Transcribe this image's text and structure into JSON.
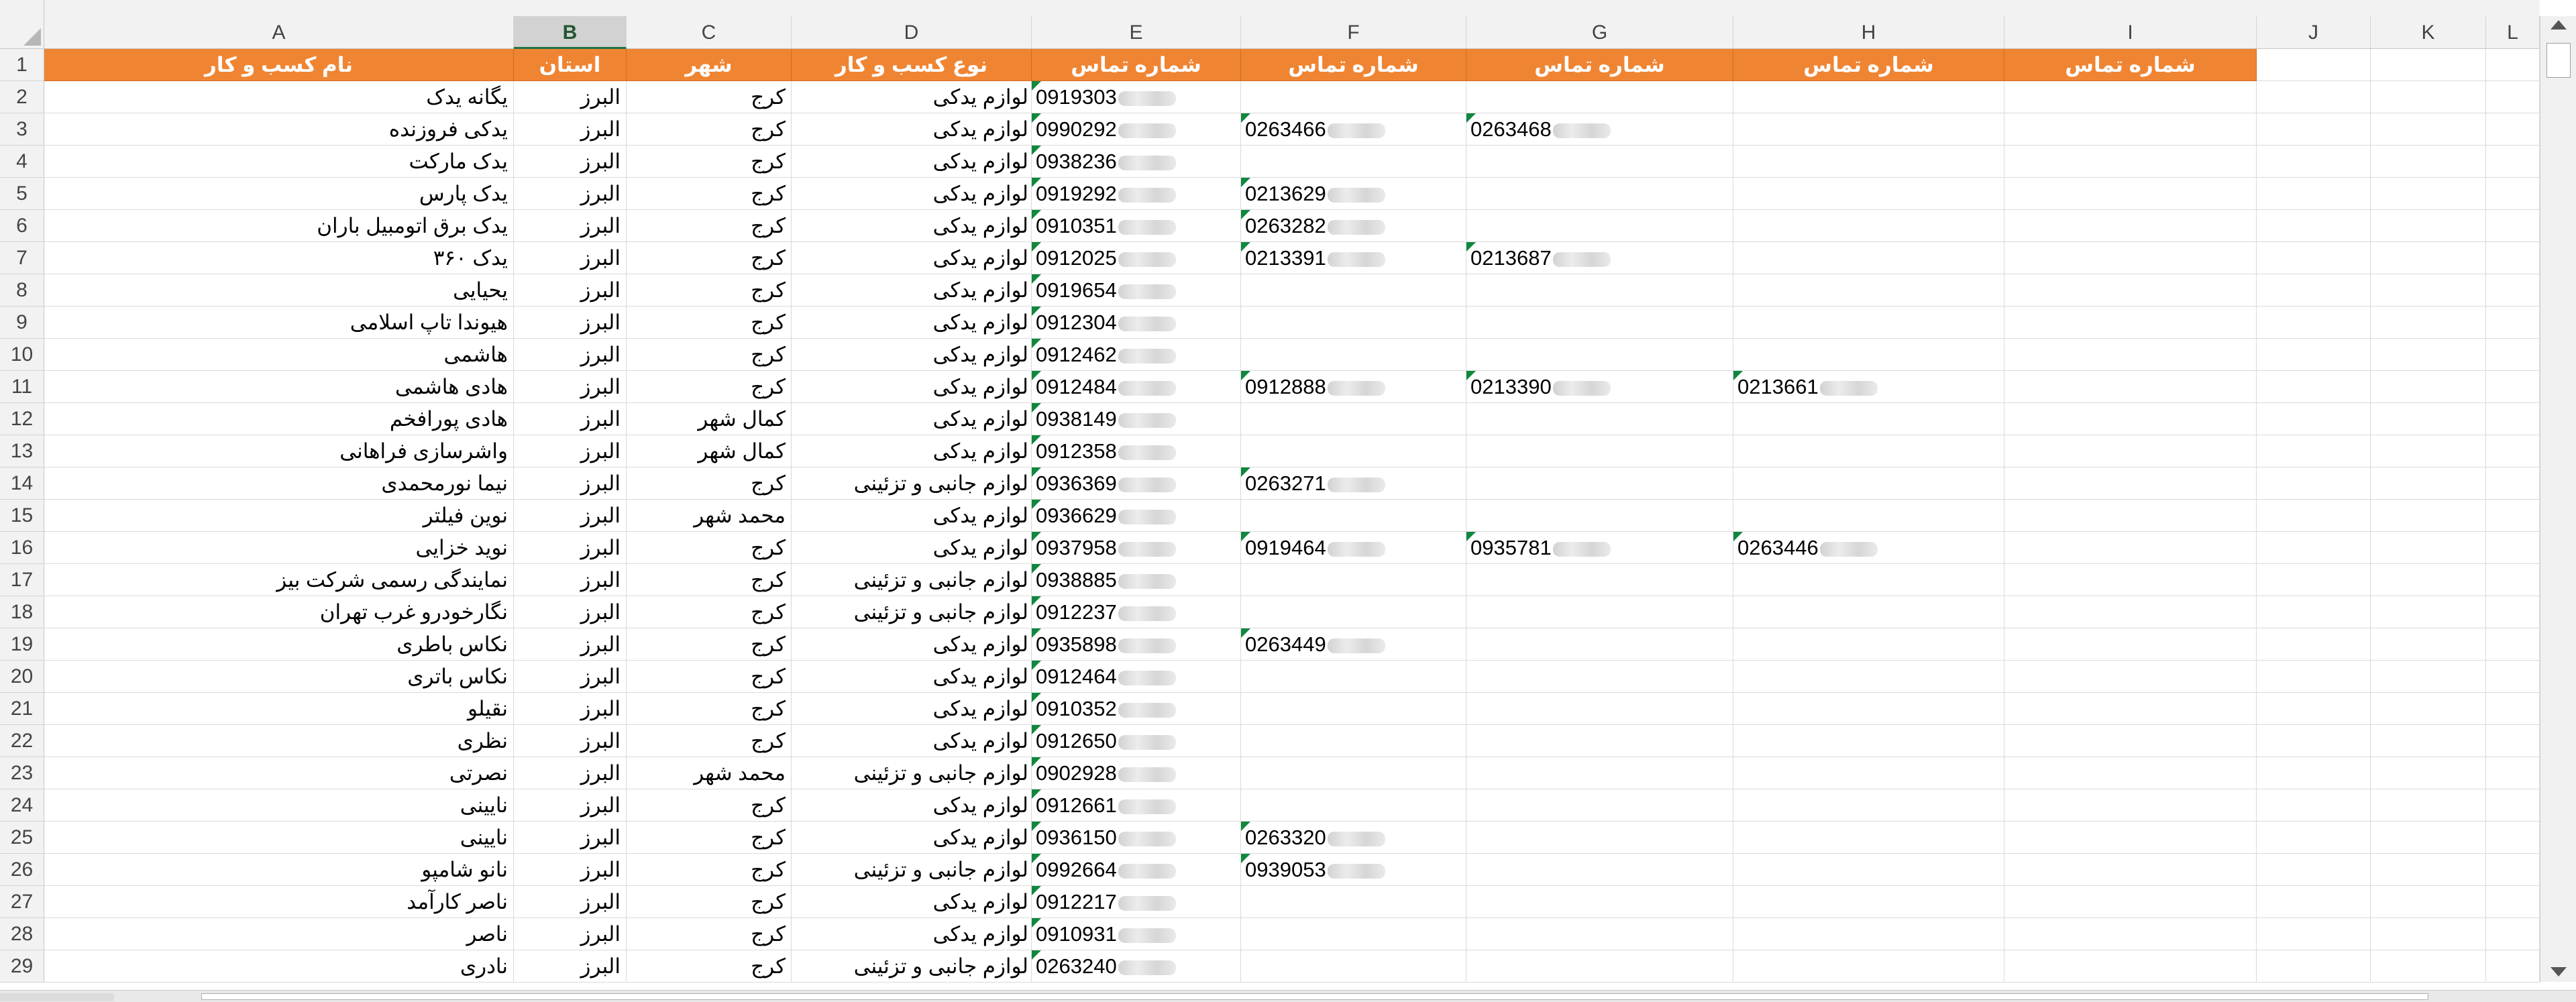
{
  "columns": [
    "A",
    "B",
    "C",
    "D",
    "E",
    "F",
    "G",
    "H",
    "I",
    "J",
    "K",
    "L"
  ],
  "selected_column": "B",
  "header_row": {
    "row_number": "1",
    "A": "نام کسب و کار",
    "B": "استان",
    "C": "شهر",
    "D": "نوع کسب و کار",
    "E": "شماره تماس",
    "F": "شماره تماس",
    "G": "شماره تماس",
    "H": "شماره تماس",
    "I": "شماره تماس"
  },
  "rows": [
    {
      "n": "2",
      "name": "یگانه یدک",
      "province": "البرز",
      "city": "کرج",
      "type": "لوازم یدکی",
      "e": "0919303",
      "f": "",
      "g": "",
      "h": ""
    },
    {
      "n": "3",
      "name": "یدکی فروزنده",
      "province": "البرز",
      "city": "کرج",
      "type": "لوازم یدکی",
      "e": "0990292",
      "f": "0263466",
      "g": "0263468",
      "h": ""
    },
    {
      "n": "4",
      "name": "یدک مارکت",
      "province": "البرز",
      "city": "کرج",
      "type": "لوازم یدکی",
      "e": "0938236",
      "f": "",
      "g": "",
      "h": ""
    },
    {
      "n": "5",
      "name": "یدک پارس",
      "province": "البرز",
      "city": "کرج",
      "type": "لوازم یدکی",
      "e": "0919292",
      "f": "0213629",
      "g": "",
      "h": ""
    },
    {
      "n": "6",
      "name": "یدک برق اتومبیل باران",
      "province": "البرز",
      "city": "کرج",
      "type": "لوازم یدکی",
      "e": "0910351",
      "f": "0263282",
      "g": "",
      "h": ""
    },
    {
      "n": "7",
      "name": "یدک ۳۶۰",
      "province": "البرز",
      "city": "کرج",
      "type": "لوازم یدکی",
      "e": "0912025",
      "f": "0213391",
      "g": "0213687",
      "h": ""
    },
    {
      "n": "8",
      "name": "یحیایی",
      "province": "البرز",
      "city": "کرج",
      "type": "لوازم یدکی",
      "e": "0919654",
      "f": "",
      "g": "",
      "h": ""
    },
    {
      "n": "9",
      "name": "هیوندا تاپ اسلامی",
      "province": "البرز",
      "city": "کرج",
      "type": "لوازم یدکی",
      "e": "0912304",
      "f": "",
      "g": "",
      "h": ""
    },
    {
      "n": "10",
      "name": "هاشمی",
      "province": "البرز",
      "city": "کرج",
      "type": "لوازم یدکی",
      "e": "0912462",
      "f": "",
      "g": "",
      "h": ""
    },
    {
      "n": "11",
      "name": "هادی هاشمی",
      "province": "البرز",
      "city": "کرج",
      "type": "لوازم یدکی",
      "e": "0912484",
      "f": "0912888",
      "g": "0213390",
      "h": "0213661"
    },
    {
      "n": "12",
      "name": "هادی پورافخم",
      "province": "البرز",
      "city": "کمال شهر",
      "type": "لوازم یدکی",
      "e": "0938149",
      "f": "",
      "g": "",
      "h": ""
    },
    {
      "n": "13",
      "name": "واشرسازی فراهانی",
      "province": "البرز",
      "city": "کمال شهر",
      "type": "لوازم یدکی",
      "e": "0912358",
      "f": "",
      "g": "",
      "h": ""
    },
    {
      "n": "14",
      "name": "نیما نورمحمدی",
      "province": "البرز",
      "city": "کرج",
      "type": "لوازم جانبی و تزئینی",
      "e": "0936369",
      "f": "0263271",
      "g": "",
      "h": ""
    },
    {
      "n": "15",
      "name": "نوین فیلتر",
      "province": "البرز",
      "city": "محمد شهر",
      "type": "لوازم یدکی",
      "e": "0936629",
      "f": "",
      "g": "",
      "h": ""
    },
    {
      "n": "16",
      "name": "نوید خزایی",
      "province": "البرز",
      "city": "کرج",
      "type": "لوازم یدکی",
      "e": "0937958",
      "f": "0919464",
      "g": "0935781",
      "h": "0263446"
    },
    {
      "n": "17",
      "name": "نمایندگی رسمی شرکت بیز",
      "province": "البرز",
      "city": "کرج",
      "type": "لوازم جانبی و تزئینی",
      "e": "0938885",
      "f": "",
      "g": "",
      "h": ""
    },
    {
      "n": "18",
      "name": "نگارخودرو غرب تهران",
      "province": "البرز",
      "city": "کرج",
      "type": "لوازم جانبی و تزئینی",
      "e": "0912237",
      "f": "",
      "g": "",
      "h": ""
    },
    {
      "n": "19",
      "name": "نکاس باطری",
      "province": "البرز",
      "city": "کرج",
      "type": "لوازم یدکی",
      "e": "0935898",
      "f": "0263449",
      "g": "",
      "h": ""
    },
    {
      "n": "20",
      "name": "نکاس باتری",
      "province": "البرز",
      "city": "کرج",
      "type": "لوازم یدکی",
      "e": "0912464",
      "f": "",
      "g": "",
      "h": ""
    },
    {
      "n": "21",
      "name": "نقیلو",
      "province": "البرز",
      "city": "کرج",
      "type": "لوازم یدکی",
      "e": "0910352",
      "f": "",
      "g": "",
      "h": ""
    },
    {
      "n": "22",
      "name": "نظری",
      "province": "البرز",
      "city": "کرج",
      "type": "لوازم یدکی",
      "e": "0912650",
      "f": "",
      "g": "",
      "h": ""
    },
    {
      "n": "23",
      "name": "نصرتی",
      "province": "البرز",
      "city": "محمد شهر",
      "type": "لوازم جانبی و تزئینی",
      "e": "0902928",
      "f": "",
      "g": "",
      "h": ""
    },
    {
      "n": "24",
      "name": "نایینی",
      "province": "البرز",
      "city": "کرج",
      "type": "لوازم یدکی",
      "e": "0912661",
      "f": "",
      "g": "",
      "h": ""
    },
    {
      "n": "25",
      "name": "نایینی",
      "province": "البرز",
      "city": "کرج",
      "type": "لوازم یدکی",
      "e": "0936150",
      "f": "0263320",
      "g": "",
      "h": ""
    },
    {
      "n": "26",
      "name": "نانو شامپو",
      "province": "البرز",
      "city": "کرج",
      "type": "لوازم جانبی و تزئینی",
      "e": "0992664",
      "f": "0939053",
      "g": "",
      "h": ""
    },
    {
      "n": "27",
      "name": "ناصر کارآمد",
      "province": "البرز",
      "city": "کرج",
      "type": "لوازم یدکی",
      "e": "0912217",
      "f": "",
      "g": "",
      "h": ""
    },
    {
      "n": "28",
      "name": "ناصر",
      "province": "البرز",
      "city": "کرج",
      "type": "لوازم یدکی",
      "e": "0910931",
      "f": "",
      "g": "",
      "h": ""
    },
    {
      "n": "29",
      "name": "نادری",
      "province": "البرز",
      "city": "کرج",
      "type": "لوازم جانبی و تزئینی",
      "e": "0263240",
      "f": "",
      "g": "",
      "h": ""
    }
  ],
  "colors": {
    "header_fill": "#ef8533",
    "header_text": "#ffffff",
    "selected_header": "#217346",
    "error_triangle": "#10873e"
  }
}
